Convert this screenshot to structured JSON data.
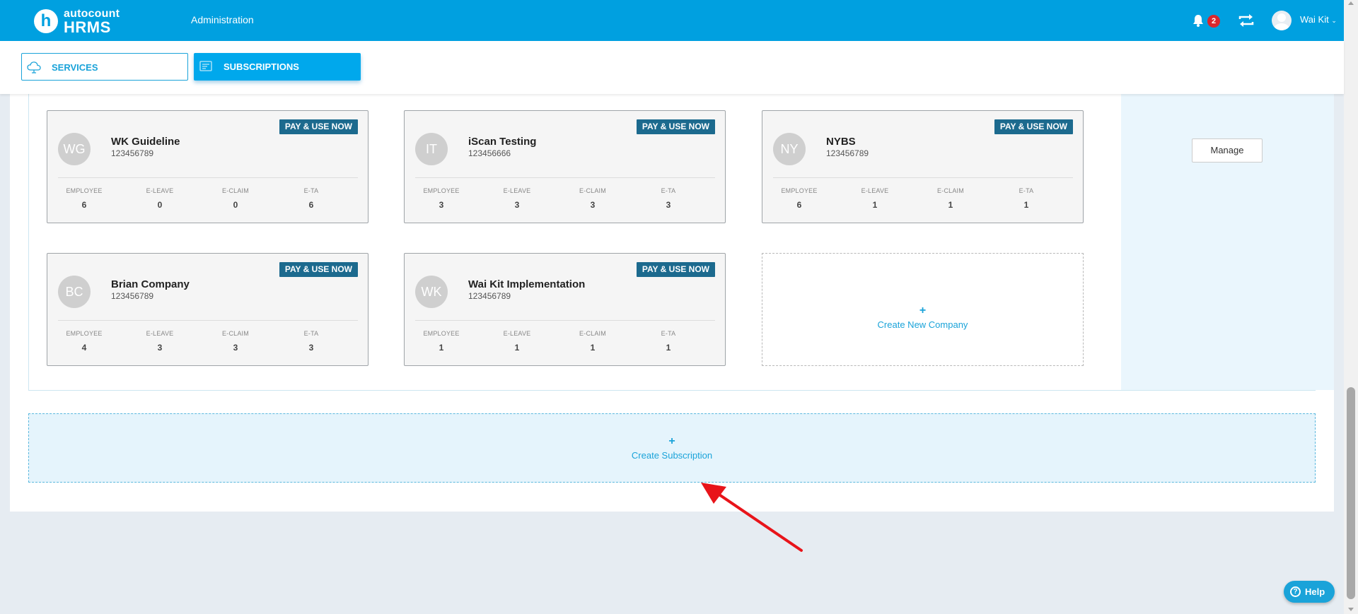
{
  "header": {
    "logo_top": "autocount",
    "logo_bottom": "HRMS",
    "logo_letter": "h",
    "nav_admin": "Administration",
    "notification_count": "2",
    "user_name": "Wai Kit"
  },
  "tabs": [
    {
      "label": "SERVICES",
      "icon": "cloud-icon",
      "active": false
    },
    {
      "label": "SUBSCRIPTIONS",
      "icon": "subscription-icon",
      "active": true
    }
  ],
  "stat_labels": [
    "EMPLOYEE",
    "E-LEAVE",
    "E-CLAIM",
    "E-TA"
  ],
  "companies": [
    {
      "initials": "WG",
      "name": "WK Guideline",
      "reg": "123456789",
      "badge": "PAY & USE NOW",
      "stats": [
        "6",
        "0",
        "0",
        "6"
      ]
    },
    {
      "initials": "IT",
      "name": "iScan Testing",
      "reg": "123456666",
      "badge": "PAY & USE NOW",
      "stats": [
        "3",
        "3",
        "3",
        "3"
      ]
    },
    {
      "initials": "NY",
      "name": "NYBS",
      "reg": "123456789",
      "badge": "PAY & USE NOW",
      "stats": [
        "6",
        "1",
        "1",
        "1"
      ]
    },
    {
      "initials": "BC",
      "name": "Brian Company",
      "reg": "123456789",
      "badge": "PAY & USE NOW",
      "stats": [
        "4",
        "3",
        "3",
        "3"
      ]
    },
    {
      "initials": "WK",
      "name": "Wai Kit Implementation",
      "reg": "123456789",
      "badge": "PAY & USE NOW",
      "stats": [
        "1",
        "1",
        "1",
        "1"
      ]
    }
  ],
  "create_company": {
    "plus": "+",
    "label": "Create New Company"
  },
  "manage_label": "Manage",
  "create_subscription": {
    "plus": "+",
    "label": "Create Subscription"
  },
  "help_label": "Help",
  "help_icon": "?",
  "colors": {
    "primary": "#00a0e0",
    "badge_bg": "#1c6a8e",
    "notification": "#d9272e",
    "annotation_arrow": "#e8141a"
  }
}
